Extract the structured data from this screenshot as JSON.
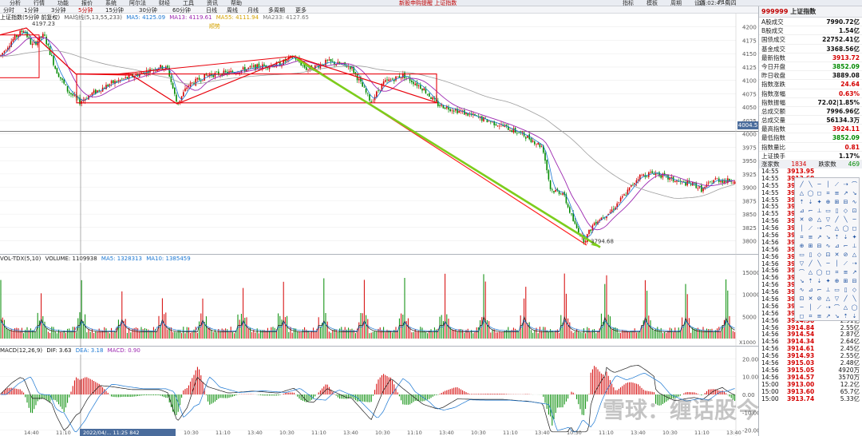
{
  "toolbar": {
    "menu_items": [
      "分析",
      "行情",
      "功能",
      "报价",
      "系统",
      "阿尔法",
      "财经",
      "工具",
      "资讯",
      "帮助"
    ],
    "center_notice": "新股申购提醒 上证指数",
    "right_time": "15:02:47 周四"
  },
  "period_bar": {
    "items": [
      "分时",
      "1分钟",
      "3分钟",
      "5分钟",
      "15分钟",
      "30分钟",
      "60分钟",
      "日线",
      "周线",
      "月线",
      "多周期",
      "更多"
    ],
    "selected": "5分钟"
  },
  "right_tabs": [
    "指标",
    "模板",
    "周期",
    "设置",
    "F10"
  ],
  "main_legend": {
    "title": "上证指数(5分钟 前复权)",
    "ma_label": "MA均线(5,13,55,233)",
    "ma5": "MA5: 4125.09",
    "ma13": "MA13: 4119.61",
    "ma55": "MA55: 4111.94",
    "ma233": "MA233: 4127.65",
    "high_label": "4197.23",
    "note": "顺势"
  },
  "vol_legend": {
    "title": "VOL-TDX(5,10)",
    "volume": "VOLUME: 1109938",
    "ma5": "MA5: 1328313",
    "ma10": "MA10: 1385459",
    "unit": "X1000"
  },
  "macd_legend": {
    "title": "MACD(12,26,9)",
    "dif": "DIF: 3.63",
    "dea": "DEA: 3.18",
    "macd": "MACD: 0.90"
  },
  "crosshair_time": "2022/04/... 11:25 842",
  "low_label": "3794.68",
  "current_marker": "4004.5",
  "quote": {
    "code": "999999",
    "name": "上证指数",
    "rows": [
      {
        "label": "A股成交",
        "value": "7990.72亿",
        "cls": "blk"
      },
      {
        "label": "B股成交",
        "value": "1.54亿",
        "cls": "blk"
      },
      {
        "label": "国债成交",
        "value": "22752.41亿",
        "cls": "blk"
      },
      {
        "label": "基金成交",
        "value": "3368.56亿",
        "cls": "blk"
      },
      {
        "label": "最新指数",
        "value": "3913.72",
        "cls": "up"
      },
      {
        "label": "今日开盘",
        "value": "3852.09",
        "cls": "dn"
      },
      {
        "label": "昨日收盘",
        "value": "3889.08",
        "cls": "blk"
      },
      {
        "label": "指数涨跌",
        "value": "24.64",
        "cls": "up"
      },
      {
        "label": "指数涨幅",
        "value": "0.63%",
        "cls": "up"
      },
      {
        "label": "指数振幅",
        "value": "72.02|1.85%",
        "cls": "blk"
      },
      {
        "label": "总成交额",
        "value": "7996.96亿",
        "cls": "blk"
      },
      {
        "label": "总成交量",
        "value": "56134.3万",
        "cls": "blk"
      },
      {
        "label": "最高指数",
        "value": "3924.11",
        "cls": "up"
      },
      {
        "label": "最低指数",
        "value": "3852.09",
        "cls": "dn"
      },
      {
        "label": "指数量比",
        "value": "0.81",
        "cls": "up"
      },
      {
        "label": "上证换手",
        "value": "1.17%",
        "cls": "blk"
      }
    ],
    "breadth": {
      "label": "涨家数",
      "up": "1834",
      "down_label": "跌家数",
      "down": "469"
    }
  },
  "ticks": [
    {
      "t": "14:55",
      "p": "3913.95",
      "q": ""
    },
    {
      "t": "14:55",
      "p": "3913.68",
      "q": ""
    },
    {
      "t": "14:55",
      "p": "3913.98",
      "q": ""
    },
    {
      "t": "14:55",
      "p": "3913.88",
      "q": ""
    },
    {
      "t": "14:55",
      "p": "3913.94",
      "q": ""
    },
    {
      "t": "14:55",
      "p": "3913.67",
      "q": ""
    },
    {
      "t": "14:55",
      "p": "3913.96",
      "q": ""
    },
    {
      "t": "14:56",
      "p": "3914.14",
      "q": ""
    },
    {
      "t": "14:56",
      "p": "3913.57",
      "q": ""
    },
    {
      "t": "14:56",
      "p": "3914.28",
      "q": ""
    },
    {
      "t": "14:56",
      "p": "3913.97",
      "q": ""
    },
    {
      "t": "14:56",
      "p": "3914.24",
      "q": ""
    },
    {
      "t": "14:56",
      "p": "3913.75",
      "q": ""
    },
    {
      "t": "14:56",
      "p": "3914.10",
      "q": ""
    },
    {
      "t": "14:56",
      "p": "3914.35",
      "q": ""
    },
    {
      "t": "14:56",
      "p": "3914.10",
      "q": ""
    },
    {
      "t": "14:56",
      "p": "3914.47",
      "q": ""
    },
    {
      "t": "14:56",
      "p": "3914.30",
      "q": ""
    },
    {
      "t": "14:56",
      "p": "3914.17",
      "q": ""
    },
    {
      "t": "14:56",
      "p": "3914.45",
      "q": "3.88亿"
    },
    {
      "t": "14:56",
      "p": "3914.62",
      "q": "3.27亿"
    },
    {
      "t": "14:56",
      "p": "3914.38",
      "q": "2.91亿"
    },
    {
      "t": "14:56",
      "p": "3914.84",
      "q": "2.55亿"
    },
    {
      "t": "14:56",
      "p": "3914.54",
      "q": "2.87亿"
    },
    {
      "t": "14:56",
      "p": "3914.34",
      "q": "2.64亿"
    },
    {
      "t": "14:56",
      "p": "3914.61",
      "q": "2.45亿"
    },
    {
      "t": "14:56",
      "p": "3914.93",
      "q": "2.55亿"
    },
    {
      "t": "14:56",
      "p": "3915.03",
      "q": "2.48亿"
    },
    {
      "t": "14:56",
      "p": "3915.05",
      "q": "4920万"
    },
    {
      "t": "14:56",
      "p": "3914.57",
      "q": "3570万"
    },
    {
      "t": "15:00",
      "p": "3913.00",
      "q": "12.2亿"
    },
    {
      "t": "15:00",
      "p": "3913.60",
      "q": "65.7亿"
    },
    {
      "t": "15:00",
      "p": "3913.74",
      "q": "5.33亿"
    }
  ],
  "watermark": "雪球：缠话股今",
  "price_axis": [
    "4200",
    "4175",
    "4150",
    "4125",
    "4100",
    "4075",
    "4050",
    "4025",
    "4000",
    "3975",
    "3950",
    "3925",
    "3900",
    "3875",
    "3850",
    "3825",
    "3800"
  ],
  "vol_axis": [
    "15000",
    "10000",
    "5000"
  ],
  "macd_axis": [
    "20.00",
    "10.00",
    "0.00",
    "-10.00",
    "-20.00"
  ],
  "time_axis": [
    "14:40",
    "11:10",
    "13:40",
    "10:30",
    "13:40",
    "10:30",
    "11:10",
    "13:40",
    "10:30",
    "11:10",
    "13:40",
    "10:30",
    "11:10",
    "13:40",
    "10:30",
    "11:10",
    "13:40",
    "10:30",
    "11:10",
    "13:40",
    "10:30",
    "11:10",
    "13:40"
  ],
  "colors": {
    "up": "#d40000",
    "down": "#008a00",
    "price_line": "#1a1a1a",
    "ma5": "#1976d2",
    "ma13": "#9c27b0",
    "ma233": "#9e9e9e",
    "box": "#e8000a",
    "arrow_green": "#7ccd1c",
    "arrow_red": "#ff2020"
  }
}
